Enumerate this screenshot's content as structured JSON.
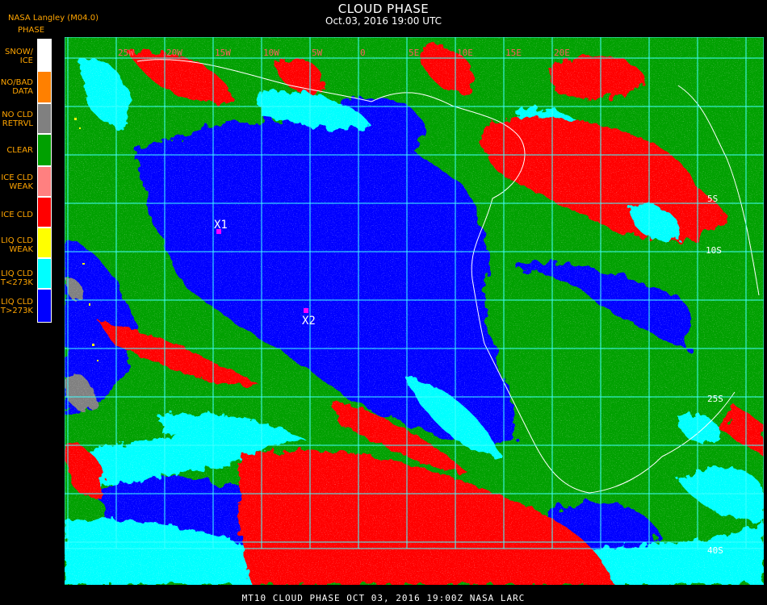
{
  "header": {
    "title": "CLOUD PHASE",
    "datetime": "Oct.03, 2016 19:00 UTC",
    "source": "NASA Langley (M04.0)",
    "product_label": "PHASE"
  },
  "legend": [
    {
      "label": "SNOW/\nICE",
      "color": "#ffffff"
    },
    {
      "label": "NO/BAD\nDATA",
      "color": "#ff8000"
    },
    {
      "label": "NO CLD\nRETRVL",
      "color": "#808080"
    },
    {
      "label": "CLEAR",
      "color": "#00a000"
    },
    {
      "label": "ICE CLD\nWEAK",
      "color": "#ff8080"
    },
    {
      "label": "ICE CLD",
      "color": "#ff0000"
    },
    {
      "label": "LIQ CLD\nWEAK",
      "color": "#ffff00"
    },
    {
      "label": "LIQ CLD\nT<273K",
      "color": "#00ffff"
    },
    {
      "label": "LIQ CLD\nT>273K",
      "color": "#0000ff"
    }
  ],
  "map": {
    "grid_color": "#40ffff",
    "coast_color": "#ffffff",
    "lon_labels": [
      "25W",
      "20W",
      "15W",
      "10W",
      "5W",
      "0",
      "5E",
      "10E",
      "15E",
      "20E"
    ],
    "lat_labels": [
      "5S",
      "10S",
      "25S",
      "40S"
    ],
    "markers": [
      {
        "label": "X1",
        "color": "#ff00ff"
      },
      {
        "label": "X2",
        "color": "#ff00ff"
      }
    ]
  },
  "footer": "MT10  CLOUD PHASE   OCT 03, 2016 19:00Z   NASA LARC"
}
